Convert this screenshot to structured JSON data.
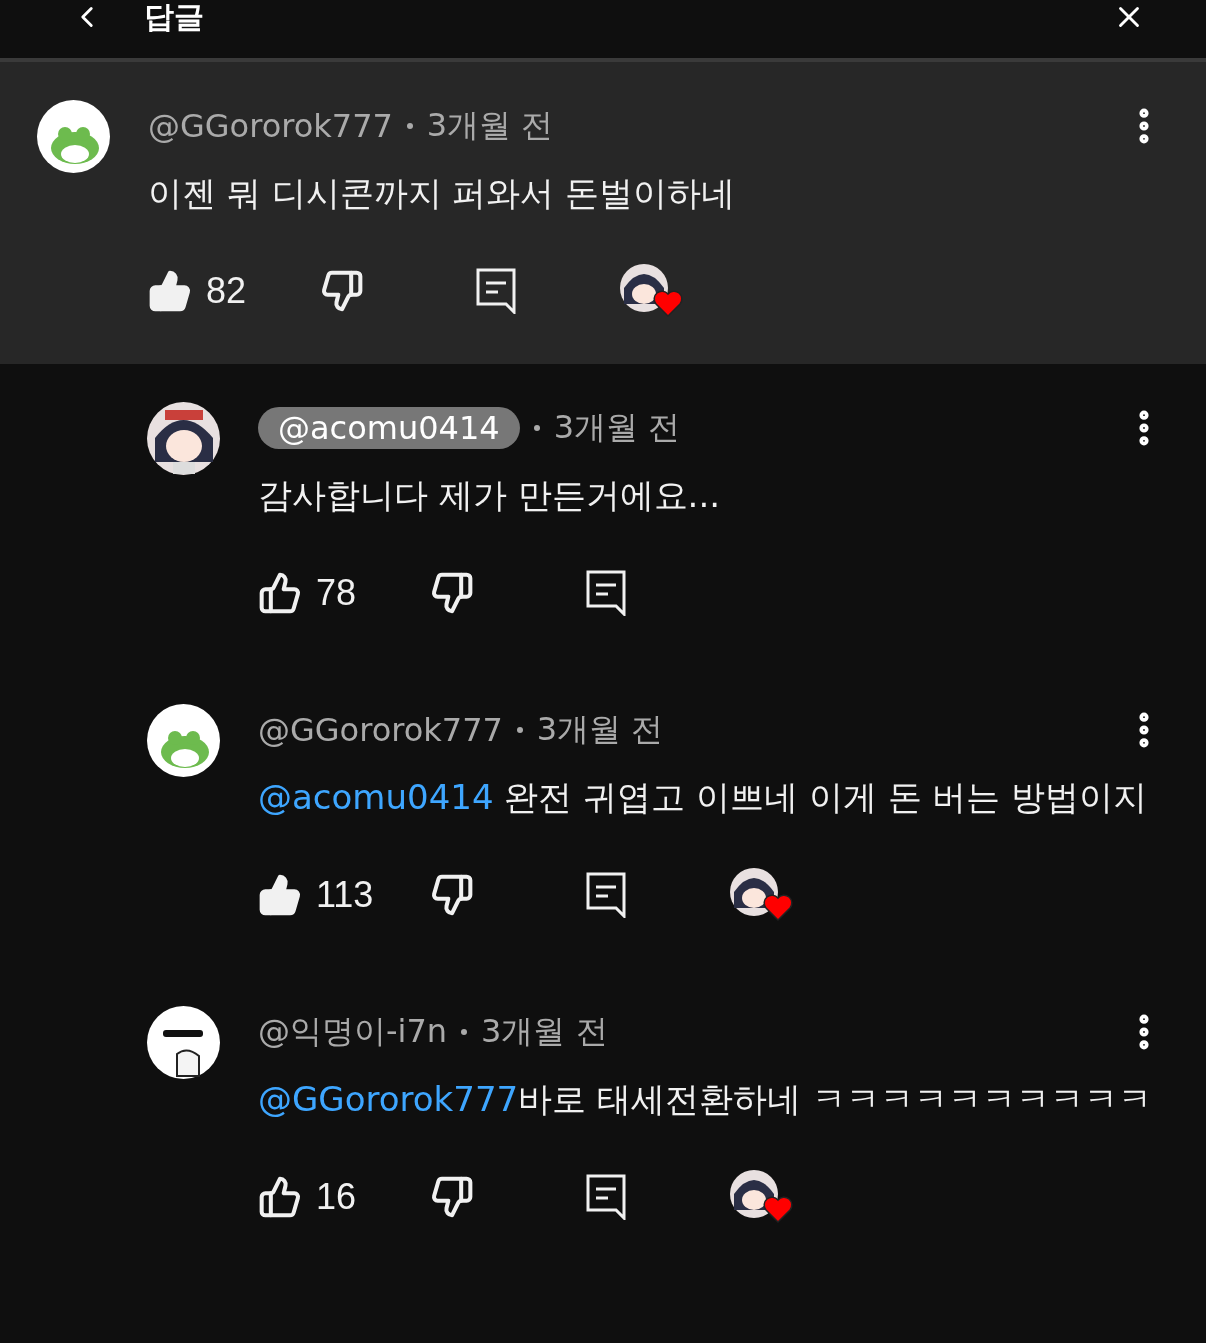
{
  "header": {
    "title": "답글"
  },
  "comments": [
    {
      "avatar": {
        "kind": "frog"
      },
      "author": "@GGororok777",
      "author_creator": false,
      "time": "3개월 전",
      "body": "이젠 뭐 디시콘까지 퍼와서 돈벌이하네",
      "liked": true,
      "likes": "82",
      "creator_heart": true,
      "highlighted": true
    },
    {
      "avatar": {
        "kind": "girl"
      },
      "author": "@acomu0414",
      "author_creator": true,
      "time": "3개월 전",
      "body": "감사합니다 제가 만든거에요...",
      "liked": false,
      "likes": "78",
      "creator_heart": false,
      "highlighted": false
    },
    {
      "avatar": {
        "kind": "frog"
      },
      "author": "@GGororok777",
      "author_creator": false,
      "time": "3개월 전",
      "mention": "@acomu0414",
      "body": " 완전 귀엽고 이쁘네 이게 돈 버는 방법이지",
      "liked": true,
      "likes": "113",
      "creator_heart": true,
      "highlighted": false
    },
    {
      "avatar": {
        "kind": "white"
      },
      "author": "@익명이-i7n",
      "author_creator": false,
      "time": "3개월 전",
      "mention": "@GGororok777",
      "body": "바로 태세전환하네 ㅋㅋㅋㅋㅋㅋㅋㅋㅋㅋ",
      "liked": false,
      "likes": "16",
      "creator_heart": true,
      "highlighted": false
    }
  ]
}
